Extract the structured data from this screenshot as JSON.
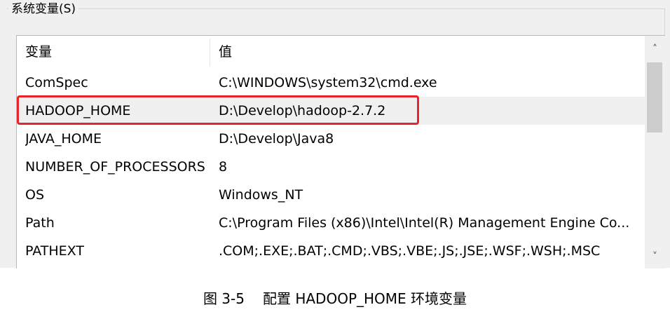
{
  "group_box": {
    "title": "系统变量(S)"
  },
  "table": {
    "columns": [
      "变量",
      "值"
    ],
    "rows": [
      {
        "name": "ComSpec",
        "value": "C:\\WINDOWS\\system32\\cmd.exe"
      },
      {
        "name": "HADOOP_HOME",
        "value": "D:\\Develop\\hadoop-2.7.2"
      },
      {
        "name": "JAVA_HOME",
        "value": "D:\\Develop\\Java8"
      },
      {
        "name": "NUMBER_OF_PROCESSORS",
        "value": "8"
      },
      {
        "name": "OS",
        "value": "Windows_NT"
      },
      {
        "name": "Path",
        "value": "C:\\Program Files (x86)\\Intel\\Intel(R) Management Engine Co..."
      },
      {
        "name": "PATHEXT",
        "value": ".COM;.EXE;.BAT;.CMD;.VBS;.VBE;.JS;.JSE;.WSF;.WSH;.MSC"
      }
    ],
    "selected_row": "HADOOP_HOME"
  },
  "scrollbar": {
    "up_glyph": "˄",
    "down_glyph": "˅"
  },
  "caption": {
    "number": "图 3-5",
    "text": "配置 HADOOP_HOME 环境变量"
  },
  "colors": {
    "highlight": "#e8242b",
    "selected_row": "#f0f0f0"
  }
}
